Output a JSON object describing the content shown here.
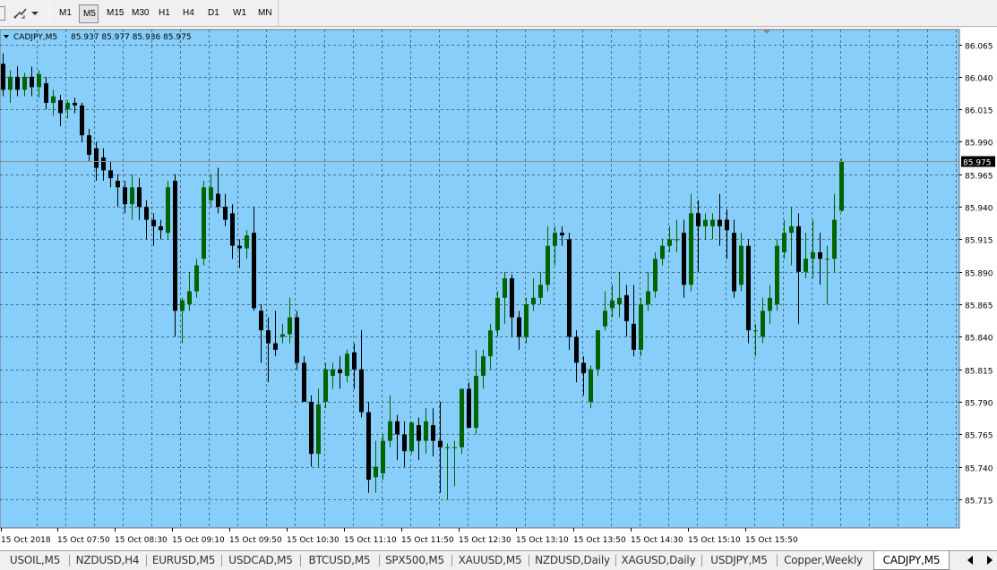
{
  "toolbar": {
    "timeframes": [
      "M1",
      "M5",
      "M15",
      "M30",
      "H1",
      "H4",
      "D1",
      "W1",
      "MN"
    ],
    "active_timeframe": "M5",
    "shape_icon": "line-draw-icon",
    "dropdown_icon": "chevron-down-icon"
  },
  "chart": {
    "symbol_header": "CADJPY,M5",
    "ohlc_values": "85.937 85.977 85.936 85.975",
    "current_price": "85.975",
    "background_color": "#87cefa",
    "bull_color": "#006400",
    "bear_color": "#000000",
    "grid_style": "dashed",
    "price_levels": [
      "86.065",
      "86.040",
      "86.015",
      "85.990",
      "85.965",
      "85.940",
      "85.915",
      "85.890",
      "85.865",
      "85.840",
      "85.815",
      "85.790",
      "85.765",
      "85.740",
      "85.715"
    ],
    "time_labels": [
      "15 Oct 2018",
      "15 Oct 07:50",
      "15 Oct 08:30",
      "15 Oct 09:10",
      "15 Oct 09:50",
      "15 Oct 10:30",
      "15 Oct 11:10",
      "15 Oct 11:50",
      "15 Oct 12:30",
      "15 Oct 13:10",
      "15 Oct 13:50",
      "15 Oct 14:30",
      "15 Oct 15:10",
      "15 Oct 15:50"
    ]
  },
  "chart_data": {
    "type": "candlestick",
    "symbol": "CADJPY",
    "timeframe": "M5",
    "ylim": [
      85.711,
      86.067
    ],
    "y_ticks": [
      86.065,
      86.04,
      86.015,
      85.99,
      85.965,
      85.94,
      85.915,
      85.89,
      85.865,
      85.84,
      85.815,
      85.79,
      85.765,
      85.74,
      85.715
    ],
    "x_tick_labels": [
      "15 Oct 2018",
      "15 Oct 07:50",
      "15 Oct 08:30",
      "15 Oct 09:10",
      "15 Oct 09:50",
      "15 Oct 10:30",
      "15 Oct 11:10",
      "15 Oct 11:50",
      "15 Oct 12:30",
      "15 Oct 13:10",
      "15 Oct 13:50",
      "15 Oct 14:30",
      "15 Oct 15:10",
      "15 Oct 15:50"
    ],
    "current_price": 85.975,
    "candles": [
      {
        "o": 86.05,
        "h": 86.058,
        "l": 86.025,
        "c": 86.03
      },
      {
        "o": 86.03,
        "h": 86.045,
        "l": 86.02,
        "c": 86.04
      },
      {
        "o": 86.04,
        "h": 86.048,
        "l": 86.025,
        "c": 86.03
      },
      {
        "o": 86.03,
        "h": 86.043,
        "l": 86.025,
        "c": 86.04
      },
      {
        "o": 86.04,
        "h": 86.048,
        "l": 86.025,
        "c": 86.032
      },
      {
        "o": 86.032,
        "h": 86.045,
        "l": 86.024,
        "c": 86.042
      },
      {
        "o": 86.035,
        "h": 86.04,
        "l": 86.015,
        "c": 86.02
      },
      {
        "o": 86.02,
        "h": 86.03,
        "l": 86.01,
        "c": 86.025
      },
      {
        "o": 86.022,
        "h": 86.026,
        "l": 86.002,
        "c": 86.012
      },
      {
        "o": 86.015,
        "h": 86.022,
        "l": 86.008,
        "c": 86.02
      },
      {
        "o": 86.02,
        "h": 86.024,
        "l": 86.012,
        "c": 86.018
      },
      {
        "o": 86.018,
        "h": 86.02,
        "l": 85.99,
        "c": 85.995
      },
      {
        "o": 85.995,
        "h": 86.0,
        "l": 85.975,
        "c": 85.98
      },
      {
        "o": 85.985,
        "h": 85.99,
        "l": 85.96,
        "c": 85.97
      },
      {
        "o": 85.978,
        "h": 85.985,
        "l": 85.96,
        "c": 85.968
      },
      {
        "o": 85.968,
        "h": 85.975,
        "l": 85.955,
        "c": 85.962
      },
      {
        "o": 85.96,
        "h": 85.965,
        "l": 85.94,
        "c": 85.955
      },
      {
        "o": 85.955,
        "h": 85.96,
        "l": 85.935,
        "c": 85.942
      },
      {
        "o": 85.942,
        "h": 85.965,
        "l": 85.93,
        "c": 85.955
      },
      {
        "o": 85.955,
        "h": 85.962,
        "l": 85.93,
        "c": 85.94
      },
      {
        "o": 85.94,
        "h": 85.945,
        "l": 85.915,
        "c": 85.93
      },
      {
        "o": 85.93,
        "h": 85.935,
        "l": 85.91,
        "c": 85.925
      },
      {
        "o": 85.925,
        "h": 85.93,
        "l": 85.915,
        "c": 85.922
      },
      {
        "o": 85.92,
        "h": 85.96,
        "l": 85.915,
        "c": 85.955
      },
      {
        "o": 85.96,
        "h": 85.965,
        "l": 85.84,
        "c": 85.86
      },
      {
        "o": 85.86,
        "h": 85.87,
        "l": 85.835,
        "c": 85.868
      },
      {
        "o": 85.865,
        "h": 85.89,
        "l": 85.86,
        "c": 85.875
      },
      {
        "o": 85.875,
        "h": 85.9,
        "l": 85.87,
        "c": 85.895
      },
      {
        "o": 85.9,
        "h": 85.96,
        "l": 85.895,
        "c": 85.955
      },
      {
        "o": 85.945,
        "h": 85.965,
        "l": 85.94,
        "c": 85.955
      },
      {
        "o": 85.95,
        "h": 85.97,
        "l": 85.935,
        "c": 85.94
      },
      {
        "o": 85.94,
        "h": 85.95,
        "l": 85.925,
        "c": 85.93
      },
      {
        "o": 85.935,
        "h": 85.942,
        "l": 85.9,
        "c": 85.91
      },
      {
        "o": 85.91,
        "h": 85.915,
        "l": 85.893,
        "c": 85.908
      },
      {
        "o": 85.908,
        "h": 85.922,
        "l": 85.9,
        "c": 85.918
      },
      {
        "o": 85.92,
        "h": 85.94,
        "l": 85.86,
        "c": 85.862
      },
      {
        "o": 85.86,
        "h": 85.865,
        "l": 85.82,
        "c": 85.845
      },
      {
        "o": 85.845,
        "h": 85.855,
        "l": 85.805,
        "c": 85.835
      },
      {
        "o": 85.835,
        "h": 85.86,
        "l": 85.825,
        "c": 85.83
      },
      {
        "o": 85.84,
        "h": 85.85,
        "l": 85.835,
        "c": 85.842
      },
      {
        "o": 85.842,
        "h": 85.87,
        "l": 85.835,
        "c": 85.855
      },
      {
        "o": 85.855,
        "h": 85.86,
        "l": 85.815,
        "c": 85.82
      },
      {
        "o": 85.82,
        "h": 85.825,
        "l": 85.79,
        "c": 85.79
      },
      {
        "o": 85.79,
        "h": 85.795,
        "l": 85.74,
        "c": 85.75
      },
      {
        "o": 85.75,
        "h": 85.8,
        "l": 85.74,
        "c": 85.788
      },
      {
        "o": 85.79,
        "h": 85.82,
        "l": 85.785,
        "c": 85.815
      },
      {
        "o": 85.81,
        "h": 85.82,
        "l": 85.8,
        "c": 85.815
      },
      {
        "o": 85.815,
        "h": 85.825,
        "l": 85.8,
        "c": 85.812
      },
      {
        "o": 85.81,
        "h": 85.83,
        "l": 85.805,
        "c": 85.827
      },
      {
        "o": 85.828,
        "h": 85.835,
        "l": 85.8,
        "c": 85.815
      },
      {
        "o": 85.815,
        "h": 85.845,
        "l": 85.778,
        "c": 85.782
      },
      {
        "o": 85.782,
        "h": 85.79,
        "l": 85.72,
        "c": 85.73
      },
      {
        "o": 85.732,
        "h": 85.76,
        "l": 85.72,
        "c": 85.74
      },
      {
        "o": 85.735,
        "h": 85.765,
        "l": 85.73,
        "c": 85.76
      },
      {
        "o": 85.76,
        "h": 85.795,
        "l": 85.755,
        "c": 85.775
      },
      {
        "o": 85.775,
        "h": 85.78,
        "l": 85.745,
        "c": 85.765
      },
      {
        "o": 85.765,
        "h": 85.775,
        "l": 85.74,
        "c": 85.752
      },
      {
        "o": 85.752,
        "h": 85.775,
        "l": 85.75,
        "c": 85.774
      },
      {
        "o": 85.772,
        "h": 85.778,
        "l": 85.745,
        "c": 85.76
      },
      {
        "o": 85.76,
        "h": 85.785,
        "l": 85.75,
        "c": 85.775
      },
      {
        "o": 85.772,
        "h": 85.785,
        "l": 85.748,
        "c": 85.76
      },
      {
        "o": 85.76,
        "h": 85.79,
        "l": 85.72,
        "c": 85.755
      },
      {
        "o": 85.755,
        "h": 85.758,
        "l": 85.715,
        "c": 85.755
      },
      {
        "o": 85.755,
        "h": 85.76,
        "l": 85.725,
        "c": 85.755
      },
      {
        "o": 85.755,
        "h": 85.8,
        "l": 85.75,
        "c": 85.8
      },
      {
        "o": 85.8,
        "h": 85.805,
        "l": 85.77,
        "c": 85.77
      },
      {
        "o": 85.77,
        "h": 85.83,
        "l": 85.765,
        "c": 85.81
      },
      {
        "o": 85.81,
        "h": 85.83,
        "l": 85.8,
        "c": 85.825
      },
      {
        "o": 85.825,
        "h": 85.85,
        "l": 85.815,
        "c": 85.845
      },
      {
        "o": 85.845,
        "h": 85.875,
        "l": 85.84,
        "c": 85.87
      },
      {
        "o": 85.87,
        "h": 85.89,
        "l": 85.85,
        "c": 85.885
      },
      {
        "o": 85.885,
        "h": 85.888,
        "l": 85.84,
        "c": 85.855
      },
      {
        "o": 85.855,
        "h": 85.86,
        "l": 85.83,
        "c": 85.84
      },
      {
        "o": 85.84,
        "h": 85.87,
        "l": 85.835,
        "c": 85.865
      },
      {
        "o": 85.865,
        "h": 85.885,
        "l": 85.86,
        "c": 85.87
      },
      {
        "o": 85.87,
        "h": 85.89,
        "l": 85.865,
        "c": 85.88
      },
      {
        "o": 85.88,
        "h": 85.925,
        "l": 85.875,
        "c": 85.91
      },
      {
        "o": 85.91,
        "h": 85.925,
        "l": 85.895,
        "c": 85.92
      },
      {
        "o": 85.92,
        "h": 85.925,
        "l": 85.91,
        "c": 85.918
      },
      {
        "o": 85.915,
        "h": 85.92,
        "l": 85.83,
        "c": 85.84
      },
      {
        "o": 85.84,
        "h": 85.845,
        "l": 85.805,
        "c": 85.82
      },
      {
        "o": 85.82,
        "h": 85.825,
        "l": 85.795,
        "c": 85.812
      },
      {
        "o": 85.79,
        "h": 85.818,
        "l": 85.785,
        "c": 85.815
      },
      {
        "o": 85.815,
        "h": 85.845,
        "l": 85.81,
        "c": 85.845
      },
      {
        "o": 85.848,
        "h": 85.875,
        "l": 85.845,
        "c": 85.86
      },
      {
        "o": 85.862,
        "h": 85.88,
        "l": 85.855,
        "c": 85.868
      },
      {
        "o": 85.865,
        "h": 85.89,
        "l": 85.855,
        "c": 85.87
      },
      {
        "o": 85.872,
        "h": 85.88,
        "l": 85.84,
        "c": 85.852
      },
      {
        "o": 85.85,
        "h": 85.88,
        "l": 85.825,
        "c": 85.83
      },
      {
        "o": 85.83,
        "h": 85.87,
        "l": 85.825,
        "c": 85.865
      },
      {
        "o": 85.865,
        "h": 85.89,
        "l": 85.86,
        "c": 85.875
      },
      {
        "o": 85.875,
        "h": 85.905,
        "l": 85.87,
        "c": 85.9
      },
      {
        "o": 85.9,
        "h": 85.915,
        "l": 85.895,
        "c": 85.91
      },
      {
        "o": 85.91,
        "h": 85.925,
        "l": 85.905,
        "c": 85.915
      },
      {
        "o": 85.915,
        "h": 85.93,
        "l": 85.905,
        "c": 85.915
      },
      {
        "o": 85.92,
        "h": 85.93,
        "l": 85.87,
        "c": 85.88
      },
      {
        "o": 85.88,
        "h": 85.95,
        "l": 85.875,
        "c": 85.935
      },
      {
        "o": 85.935,
        "h": 85.945,
        "l": 85.89,
        "c": 85.925
      },
      {
        "o": 85.925,
        "h": 85.935,
        "l": 85.915,
        "c": 85.93
      },
      {
        "o": 85.925,
        "h": 85.935,
        "l": 85.915,
        "c": 85.93
      },
      {
        "o": 85.93,
        "h": 85.95,
        "l": 85.91,
        "c": 85.925
      },
      {
        "o": 85.93,
        "h": 85.938,
        "l": 85.9,
        "c": 85.922
      },
      {
        "o": 85.92,
        "h": 85.93,
        "l": 85.87,
        "c": 85.875
      },
      {
        "o": 85.88,
        "h": 85.92,
        "l": 85.875,
        "c": 85.91
      },
      {
        "o": 85.91,
        "h": 85.915,
        "l": 85.835,
        "c": 85.845
      },
      {
        "o": 85.845,
        "h": 85.85,
        "l": 85.825,
        "c": 85.845
      },
      {
        "o": 85.84,
        "h": 85.87,
        "l": 85.835,
        "c": 85.86
      },
      {
        "o": 85.86,
        "h": 85.88,
        "l": 85.85,
        "c": 85.87
      },
      {
        "o": 85.865,
        "h": 85.915,
        "l": 85.86,
        "c": 85.91
      },
      {
        "o": 85.905,
        "h": 85.93,
        "l": 85.9,
        "c": 85.92
      },
      {
        "o": 85.92,
        "h": 85.94,
        "l": 85.895,
        "c": 85.925
      },
      {
        "o": 85.925,
        "h": 85.935,
        "l": 85.85,
        "c": 85.89
      },
      {
        "o": 85.89,
        "h": 85.92,
        "l": 85.885,
        "c": 85.9
      },
      {
        "o": 85.9,
        "h": 85.93,
        "l": 85.885,
        "c": 85.905
      },
      {
        "o": 85.905,
        "h": 85.92,
        "l": 85.88,
        "c": 85.9
      },
      {
        "o": 85.9,
        "h": 85.91,
        "l": 85.865,
        "c": 85.9
      },
      {
        "o": 85.9,
        "h": 85.95,
        "l": 85.89,
        "c": 85.93
      },
      {
        "o": 85.937,
        "h": 85.977,
        "l": 85.936,
        "c": 85.975
      }
    ]
  },
  "tabs": [
    {
      "label": "USOIL,M5"
    },
    {
      "label": "NZDUSD,H4"
    },
    {
      "label": "EURUSD,M5"
    },
    {
      "label": "USDCAD,M5"
    },
    {
      "label": "BTCUSD,M5"
    },
    {
      "label": "SPX500,M5"
    },
    {
      "label": "XAUUSD,M5"
    },
    {
      "label": "NZDUSD,Daily"
    },
    {
      "label": "XAGUSD,Daily"
    },
    {
      "label": "USDJPY,M5"
    },
    {
      "label": "Copper,Weekly"
    },
    {
      "label": "CADJPY,M5",
      "active": true
    }
  ]
}
